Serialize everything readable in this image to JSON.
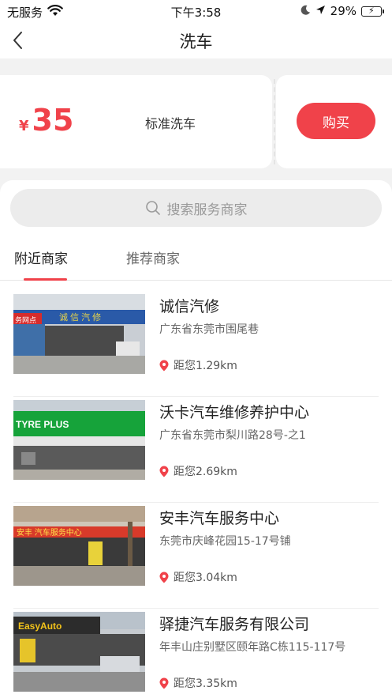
{
  "status_bar": {
    "carrier": "无服务",
    "time": "下午3:58",
    "battery_percent": "29%",
    "battery_level": 0.29
  },
  "nav": {
    "title": "洗车"
  },
  "package": {
    "currency": "¥",
    "price": "35",
    "name": "标准洗车",
    "buy_label": "购买"
  },
  "search": {
    "placeholder": "搜索服务商家"
  },
  "tabs": [
    {
      "label": "附近商家",
      "active": true
    },
    {
      "label": "推荐商家",
      "active": false
    }
  ],
  "merchants": [
    {
      "name": "诚信汽修",
      "address": "广东省东莞市围尾巷",
      "distance": "距您1.29km",
      "sign_text": "诚 信 汽 修",
      "side_text": "务网点"
    },
    {
      "name": "沃卡汽车维修养护中心",
      "address": "广东省东莞市梨川路28号-之1",
      "distance": "距您2.69km",
      "sign_text": "TYRE PLUS"
    },
    {
      "name": "安丰汽车服务中心",
      "address": "东莞市庆峰花园15-17号铺",
      "distance": "距您3.04km",
      "sign_text": "安丰 汽车服务中心"
    },
    {
      "name": "驿捷汽车服务有限公司",
      "address": "年丰山庄别墅区颐年路C栋115-117号",
      "distance": "距您3.35km",
      "sign_text": "EasyAuto"
    }
  ],
  "colors": {
    "accent": "#f0424a",
    "background": "#f2f2f2"
  }
}
